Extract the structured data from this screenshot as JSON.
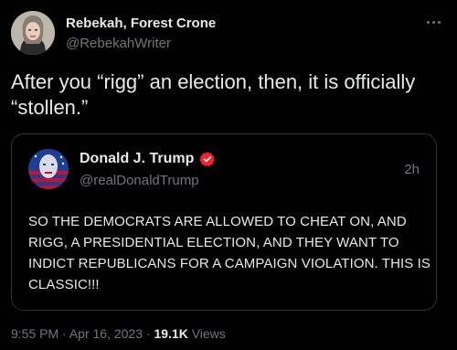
{
  "author": {
    "name": "Rebekah, Forest Crone",
    "handle": "@RebekahWriter"
  },
  "tweet_text": "After you “rigg” an election, then, it is officially “stollen.”",
  "quote": {
    "name": "Donald J. Trump",
    "handle": "@realDonaldTrump",
    "time": "2h",
    "text": "SO THE DEMOCRATS ARE ALLOWED TO CHEAT ON, AND RIGG, A PRESIDENTIAL ELECTION, AND THEY WANT TO INDICT REPUBLICANS FOR A CAMPAIGN VIOLATION. THIS IS CLASSIC!!!",
    "verified_color": "#f4212e"
  },
  "meta": {
    "time": "9:55 PM",
    "separator": "·",
    "date": "Apr 16, 2023",
    "views_count": "19.1K",
    "views_label": "Views"
  },
  "icons": {
    "more": "more-horizontal-icon",
    "verified": "verified-badge-icon"
  },
  "colors": {
    "background": "#000000",
    "text": "#e7e9ea",
    "secondary": "#71767b",
    "border": "#2f3336"
  }
}
